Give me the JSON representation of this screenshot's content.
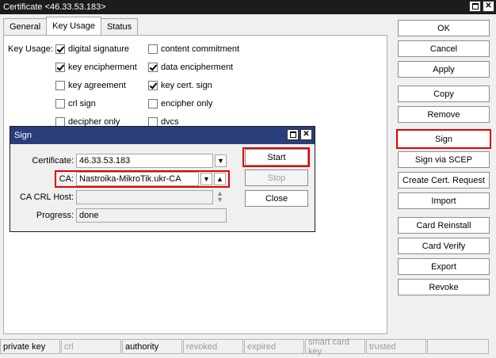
{
  "window": {
    "title": "Certificate <46.33.53.183>"
  },
  "tabs": [
    "General",
    "Key Usage",
    "Status"
  ],
  "key_usage": {
    "label": "Key Usage:",
    "options": [
      {
        "label": "digital signature",
        "checked": true
      },
      {
        "label": "content commitment",
        "checked": false
      },
      {
        "label": "key encipherment",
        "checked": true
      },
      {
        "label": "data encipherment",
        "checked": true
      },
      {
        "label": "key agreement",
        "checked": false
      },
      {
        "label": "key cert. sign",
        "checked": true
      },
      {
        "label": "crl sign",
        "checked": false
      },
      {
        "label": "encipher only",
        "checked": false
      },
      {
        "label": "decipher only",
        "checked": false
      },
      {
        "label": "dvcs",
        "checked": false
      }
    ]
  },
  "right_buttons": [
    "OK",
    "Cancel",
    "Apply",
    "Copy",
    "Remove",
    "Sign",
    "Sign via SCEP",
    "Create Cert. Request",
    "Import",
    "Card Reinstall",
    "Card Verify",
    "Export",
    "Revoke"
  ],
  "status_bar": [
    "private key",
    "crl",
    "authority",
    "revoked",
    "expired",
    "smart card key",
    "trusted"
  ],
  "sign_dialog": {
    "title": "Sign",
    "certificate_label": "Certificate:",
    "certificate_value": "46.33.53.183",
    "ca_label": "CA:",
    "ca_value": "Nastroika-MikroTik.ukr-CA",
    "ca_crl_host_label": "CA CRL Host:",
    "ca_crl_host_value": "",
    "progress_label": "Progress:",
    "progress_value": "done",
    "buttons": [
      "Start",
      "Stop",
      "Close"
    ]
  },
  "colors": {
    "highlight": "#e60000",
    "titlebar": "#1c1c1c",
    "dialog_title": "#2a3d7c"
  }
}
